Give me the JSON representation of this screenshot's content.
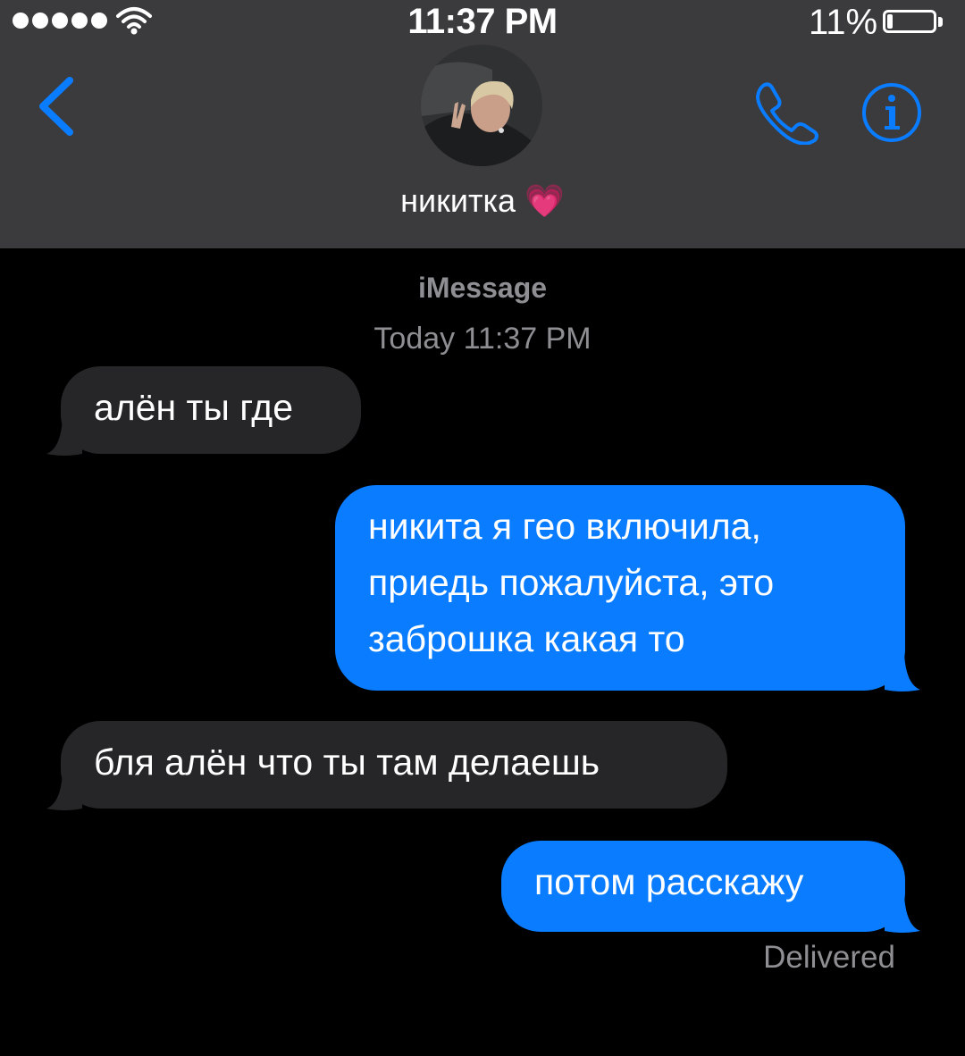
{
  "status_bar": {
    "time": "11:37 PM",
    "battery_percent": "11%",
    "battery_level": 0.11,
    "signal_bars": 5
  },
  "header": {
    "contact_name": "никитка 💗",
    "back_icon": "chevron-left-icon",
    "call_icon": "phone-icon",
    "info_icon": "info-icon",
    "accent_color": "#0a7cff"
  },
  "thread": {
    "service_label": "iMessage",
    "timestamp": "Today 11:37 PM",
    "messages": [
      {
        "direction": "incoming",
        "text": "алён ты где"
      },
      {
        "direction": "outgoing",
        "text": "никита я гео включила, приедь пожалуйста, это заброшка какая то"
      },
      {
        "direction": "incoming",
        "text": "бля алён что ты там делаешь"
      },
      {
        "direction": "outgoing",
        "text": "потом расскажу"
      }
    ],
    "delivery_status": "Delivered"
  }
}
